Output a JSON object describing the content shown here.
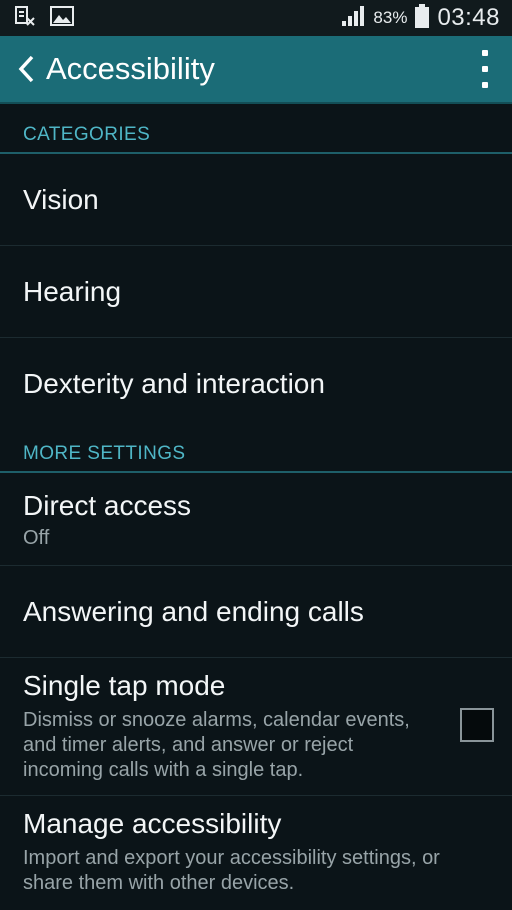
{
  "status_bar": {
    "battery_percent": "83%",
    "time": "03:48",
    "icons": [
      "screen-mirroring-off-icon",
      "gallery-notification-icon",
      "signal-strength-icon",
      "battery-icon"
    ]
  },
  "app_bar": {
    "title": "Accessibility",
    "back_icon": "back-chevron-icon",
    "menu_icon": "overflow-menu-icon"
  },
  "sections": {
    "categories": {
      "header": "CATEGORIES",
      "items": [
        "Vision",
        "Hearing",
        "Dexterity and interaction"
      ]
    },
    "more_settings": {
      "header": "MORE SETTINGS",
      "direct_access": {
        "title": "Direct access",
        "subtitle": "Off"
      },
      "answering_calls": {
        "title": "Answering and ending calls"
      },
      "single_tap": {
        "title": "Single tap mode",
        "subtitle_lines": [
          "Dismiss or snooze alarms, calendar events,",
          "and timer alerts, and answer or reject",
          "incoming calls with a single tap."
        ],
        "checked": false
      },
      "manage": {
        "title": "Manage accessibility",
        "subtitle_lines": [
          "Import and export your accessibility settings, or",
          "share them with other devices."
        ]
      }
    }
  },
  "colors": {
    "app_bar": "#1b6c77",
    "background": "#0b1418",
    "section_header_text": "#4fb6c6"
  }
}
